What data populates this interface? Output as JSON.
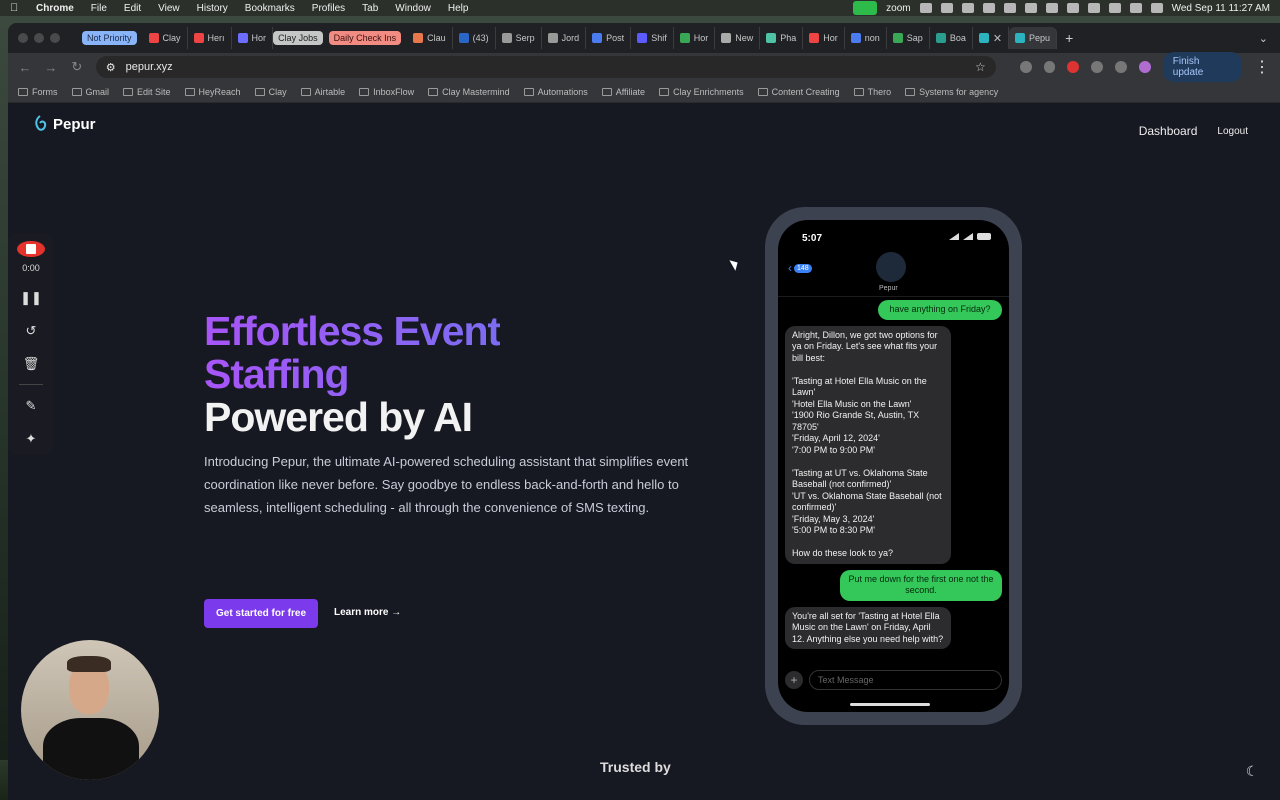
{
  "menubar": {
    "app": "Chrome",
    "items": [
      "File",
      "Edit",
      "View",
      "History",
      "Bookmarks",
      "Profiles",
      "Tab",
      "Window",
      "Help"
    ],
    "zoom_label": "zoom",
    "clock": "Wed Sep 11  11:27 AM"
  },
  "tabs": {
    "groups": [
      {
        "label": "Not Priority"
      },
      {
        "label": "Clay Jobs"
      },
      {
        "label": "Daily Check Ins"
      }
    ],
    "items": [
      {
        "label": "Clay",
        "color": "#e44"
      },
      {
        "label": "Herı",
        "color": "#e44"
      },
      {
        "label": "Hor",
        "color": "#6d6dff"
      },
      {
        "label": "Clau",
        "color": "#e8774b"
      },
      {
        "label": "(43)",
        "color": "#2a66c8"
      },
      {
        "label": "Serp",
        "color": "#999"
      },
      {
        "label": "Jord",
        "color": "#999"
      },
      {
        "label": "Post",
        "color": "#4a7cf0"
      },
      {
        "label": "Shif",
        "color": "#5b5bff"
      },
      {
        "label": "Hor",
        "color": "#3aa757"
      },
      {
        "label": "New",
        "color": "#aaa"
      },
      {
        "label": "Pha",
        "color": "#4ec3a6"
      },
      {
        "label": "Hor",
        "color": "#e44"
      },
      {
        "label": "non",
        "color": "#4a7cf0"
      },
      {
        "label": "Sap",
        "color": "#3aa757"
      },
      {
        "label": "Boa",
        "color": "#2a9d8f"
      }
    ],
    "active_label": "Pepu"
  },
  "toolbar": {
    "url": "pepur.xyz",
    "finish_update": "Finish update"
  },
  "bookmarks": [
    "Forms",
    "Gmail",
    "Edit Site",
    "HeyReach",
    "Clay",
    "Airtable",
    "InboxFlow",
    "Clay Mastermind",
    "Automations",
    "Affiliate",
    "Clay Enrichments",
    "Content Creating",
    "Thero",
    "Systems for agency"
  ],
  "site": {
    "logo": "Pepur",
    "nav_dashboard": "Dashboard",
    "nav_logout": "Logout",
    "headline_1": "Effortless Event",
    "headline_2": "Staffing",
    "headline_3": "Powered by AI",
    "intro": "Introducing Pepur, the ultimate AI-powered scheduling assistant that simplifies event coordination like never before. Say goodbye to endless back-and-forth and hello to seamless, intelligent scheduling - all through the convenience of SMS texting.",
    "cta": "Get started for free",
    "learn_more": "Learn more →",
    "trusted_by": "Trusted by"
  },
  "phone": {
    "time": "5:07",
    "back_count": "148",
    "contact": "Pepur",
    "messages": [
      {
        "dir": "out",
        "text": "have anything on Friday?"
      },
      {
        "dir": "in",
        "text": "Alright, Dillon, we got two options for ya on Friday. Let's see what fits your bill best:\n\n'Tasting at Hotel Ella Music on the Lawn'\n'Hotel Ella Music on the Lawn'\n'1900 Rio Grande St, Austin, TX 78705'\n'Friday, April 12, 2024'\n'7:00 PM to 9:00 PM'\n\n'Tasting at UT vs. Oklahoma State Baseball  (not confirmed)'\n'UT vs. Oklahoma State Baseball (not confirmed)'\n'Friday, May 3, 2024'\n'5:00 PM to 8:30 PM'\n\nHow do these look to ya?"
      },
      {
        "dir": "out",
        "text": "Put me down for the first one not the second."
      },
      {
        "dir": "in",
        "text": "You're all set for 'Tasting at Hotel Ella Music on the Lawn' on Friday, April 12. Anything else you need help with?"
      }
    ],
    "input_placeholder": "Text Message"
  },
  "recorder": {
    "time": "0:00"
  }
}
